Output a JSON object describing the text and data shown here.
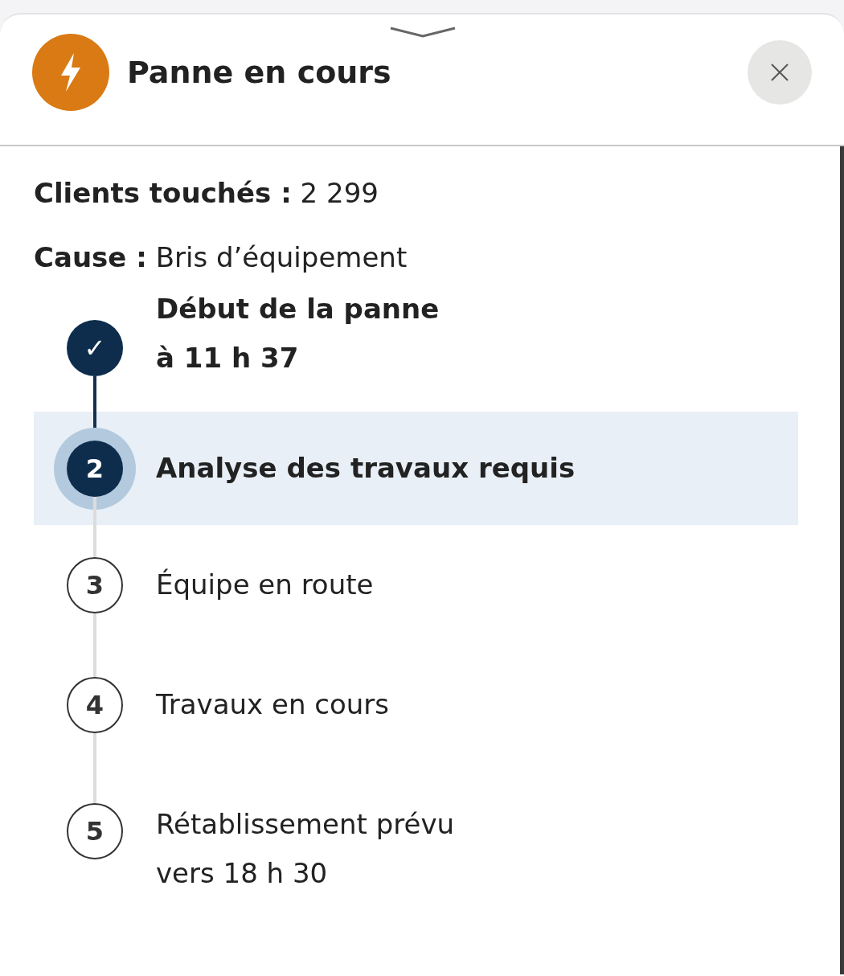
{
  "header": {
    "title": "Panne en cours"
  },
  "facts": [
    {
      "label": "Clients touchés :",
      "value": "2 299"
    },
    {
      "label": "Cause :",
      "value": "Bris d’équipement"
    }
  ],
  "steps": [
    {
      "kind": "done",
      "marker": "✓",
      "lines": [
        "Début de la panne",
        "à 11 h 37"
      ],
      "selected": false
    },
    {
      "kind": "current",
      "marker": "2",
      "lines": [
        "Analyse des travaux requis"
      ],
      "selected": true
    },
    {
      "kind": "pending",
      "marker": "3",
      "lines": [
        "Équipe en route"
      ],
      "selected": false
    },
    {
      "kind": "pending",
      "marker": "4",
      "lines": [
        "Travaux en cours"
      ],
      "selected": false
    },
    {
      "kind": "pending",
      "marker": "5",
      "lines": [
        "Rétablissement prévu",
        "vers 18 h 30"
      ],
      "selected": false
    }
  ]
}
